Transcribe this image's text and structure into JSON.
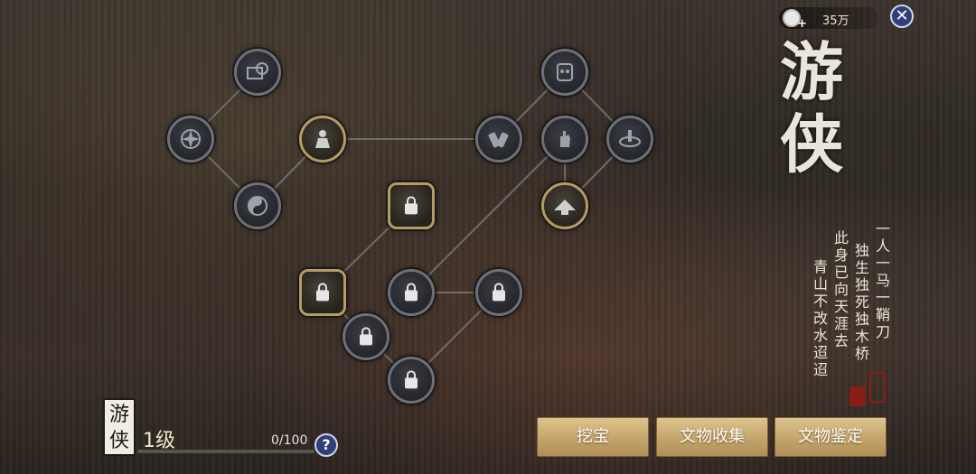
{
  "top_bar": {
    "currency_icon": "silver-coin-plus-icon",
    "currency_value": "35万",
    "close_icon": "close-icon"
  },
  "class_panel": {
    "title": "游侠",
    "poem": [
      "一人一马一鞘刀",
      "独生独死独木桥",
      "此身已向天涯去",
      "青山不改水迢迢"
    ]
  },
  "level": {
    "badge_text": "游侠",
    "level_text": "1级",
    "progress_text": "0/100",
    "progress_fraction": 0,
    "help_label": "?"
  },
  "actions": {
    "treasure_label": "挖宝",
    "collection_label": "文物收集",
    "appraisal_label": "文物鉴定"
  },
  "skill_tree": {
    "nodes": [
      {
        "id": "map",
        "icon": "map-chat-icon",
        "state": "unlocked"
      },
      {
        "id": "shuriken",
        "icon": "shuriken-icon",
        "state": "unlocked"
      },
      {
        "id": "taiji",
        "icon": "yin-yang-icon",
        "state": "unlocked"
      },
      {
        "id": "warrior",
        "icon": "warrior-icon",
        "state": "active"
      },
      {
        "id": "mask",
        "icon": "opera-mask-icon",
        "state": "unlocked"
      },
      {
        "id": "scrolls",
        "icon": "scrolls-icon",
        "state": "unlocked"
      },
      {
        "id": "hand",
        "icon": "hand-icon",
        "state": "unlocked"
      },
      {
        "id": "ring",
        "icon": "ring-icon",
        "state": "unlocked"
      },
      {
        "id": "hat",
        "icon": "straw-hat-icon",
        "state": "active"
      },
      {
        "id": "locked-gold-1",
        "icon": "lock-icon",
        "state": "locked-gold"
      },
      {
        "id": "locked-gold-2",
        "icon": "lock-icon",
        "state": "locked-gold"
      },
      {
        "id": "locked-cross",
        "icon": "lock-icon",
        "state": "locked"
      },
      {
        "id": "butterfly",
        "icon": "butterfly-lock-icon",
        "state": "locked"
      },
      {
        "id": "locked-mid",
        "icon": "lock-icon",
        "state": "locked"
      },
      {
        "id": "eye",
        "icon": "eye-lock-icon",
        "state": "locked"
      }
    ]
  }
}
